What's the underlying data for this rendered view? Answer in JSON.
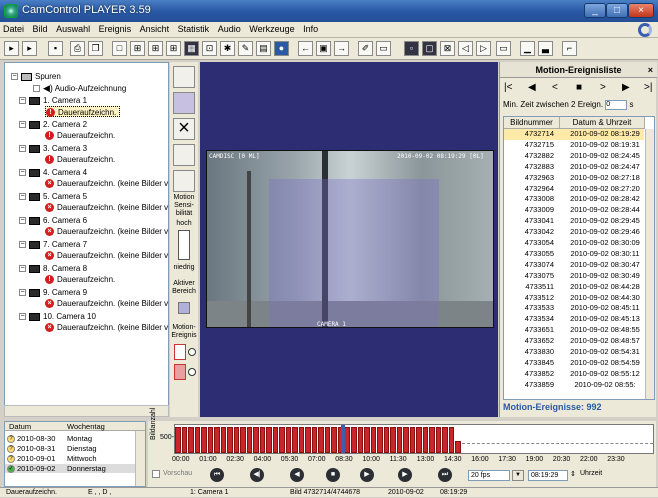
{
  "window": {
    "title": "CamControl PLAYER 3.59"
  },
  "menu": [
    "Datei",
    "Bild",
    "Auswahl",
    "Ereignis",
    "Ansicht",
    "Statistik",
    "Audio",
    "Werkzeuge",
    "Info"
  ],
  "tree": {
    "root": "Spuren",
    "audio": "Audio-Aufzeichnung",
    "items": [
      {
        "label": "1. Camera 1",
        "rec": "Daueraufzeichn.",
        "rec_state": "ok"
      },
      {
        "label": "2. Camera 2",
        "rec": "Daueraufzeichn.",
        "rec_state": "ok"
      },
      {
        "label": "3. Camera 3",
        "rec": "Daueraufzeichn.",
        "rec_state": "ok"
      },
      {
        "label": "4. Camera 4",
        "rec": "Daueraufzeichn. (keine Bilder verf",
        "rec_state": "none"
      },
      {
        "label": "5. Camera 5",
        "rec": "Daueraufzeichn. (keine Bilder verf",
        "rec_state": "none"
      },
      {
        "label": "6. Camera 6",
        "rec": "Daueraufzeichn. (keine Bilder verf",
        "rec_state": "none"
      },
      {
        "label": "7. Camera 7",
        "rec": "Daueraufzeichn. (keine Bilder verf",
        "rec_state": "none"
      },
      {
        "label": "8. Camera 8",
        "rec": "Daueraufzeichn.",
        "rec_state": "ok"
      },
      {
        "label": "9. Camera 9",
        "rec": "Daueraufzeichn. (keine Bilder verf",
        "rec_state": "none"
      },
      {
        "label": "10. Camera 10",
        "rec": "Daueraufzeichn. (keine Bilder verf",
        "rec_state": "none"
      }
    ]
  },
  "midstrip": {
    "motion_label": "Motion Sensi- bilität",
    "high": "hoch",
    "low": "niedrig",
    "active_area": "Aktiver Bereich",
    "motion_events": "Motion- Ereignis"
  },
  "video": {
    "osd_left": "CAMDISC [0 ML]",
    "osd_right": "2010-09-02 08:19:29 [0L]",
    "osd_bottom": "CAMERA 1"
  },
  "events": {
    "title": "Motion-Ereignisliste",
    "close": "×",
    "min_time_label": "Min. Zeit zwischen 2 Ereign.",
    "min_time_value": "0",
    "unit": "s",
    "col_id": "Bildnummer",
    "col_date": "Datum & Uhrzeit",
    "rows": [
      {
        "id": "4732714",
        "dt": "2010-09-02 08:19:29"
      },
      {
        "id": "4732715",
        "dt": "2010-09-02 08:19:31"
      },
      {
        "id": "4732882",
        "dt": "2010-09-02 08:24:45"
      },
      {
        "id": "4732883",
        "dt": "2010-09-02 08:24:47"
      },
      {
        "id": "4732963",
        "dt": "2010-09-02 08:27:18"
      },
      {
        "id": "4732964",
        "dt": "2010-09-02 08:27:20"
      },
      {
        "id": "4733008",
        "dt": "2010-09-02 08:28:42"
      },
      {
        "id": "4733009",
        "dt": "2010-09-02 08:28:44"
      },
      {
        "id": "4733041",
        "dt": "2010-09-02 08:29:45"
      },
      {
        "id": "4733042",
        "dt": "2010-09-02 08:29:46"
      },
      {
        "id": "4733054",
        "dt": "2010-09-02 08:30:09"
      },
      {
        "id": "4733055",
        "dt": "2010-09-02 08:30:11"
      },
      {
        "id": "4733074",
        "dt": "2010-09-02 08:30:47"
      },
      {
        "id": "4733075",
        "dt": "2010-09-02 08:30:49"
      },
      {
        "id": "4733511",
        "dt": "2010-09-02 08:44:28"
      },
      {
        "id": "4733512",
        "dt": "2010-09-02 08:44:30"
      },
      {
        "id": "4733533",
        "dt": "2010-09-02 08:45:11"
      },
      {
        "id": "4733534",
        "dt": "2010-09-02 08:45:13"
      },
      {
        "id": "4733651",
        "dt": "2010-09-02 08:48:55"
      },
      {
        "id": "4733652",
        "dt": "2010-09-02 08:48:57"
      },
      {
        "id": "4733830",
        "dt": "2010-09-02 08:54:31"
      },
      {
        "id": "4733845",
        "dt": "2010-09-02 08:54:59"
      },
      {
        "id": "4733852",
        "dt": "2010-09-02 08:55:12"
      },
      {
        "id": "4733859",
        "dt": "2010-09-02 08:55:"
      }
    ],
    "count_label": "Motion-Ereignisse: 992"
  },
  "dates": {
    "col_date": "Datum",
    "col_day": "Wochentag",
    "rows": [
      {
        "date": "2010-08-30",
        "day": "Montag"
      },
      {
        "date": "2010-08-31",
        "day": "Dienstag"
      },
      {
        "date": "2010-09-01",
        "day": "Mittwoch"
      },
      {
        "date": "2010-09-02",
        "day": "Donnerstag"
      }
    ]
  },
  "timeline": {
    "ylabel": "Bildanzahl",
    "ymark": "500-",
    "ticks": [
      "00:00",
      "01:00",
      "02:30",
      "04:00",
      "05:30",
      "07:00",
      "08:30",
      "10:00",
      "11:30",
      "13:00",
      "14:30",
      "16:00",
      "17:30",
      "19:00",
      "20:30",
      "22:00",
      "23:30"
    ],
    "preview_label": "Vorschau",
    "fps": "20 fps",
    "time_value": "08:19:29",
    "time_unit": "Uhrzeit",
    "bars_filled_until_fraction": 0.6
  },
  "status": {
    "s1": "Daueraufzeichn.",
    "s2": "E , , D ,",
    "s3": "1: Camera 1",
    "s4": "Bild 4732714/4744678",
    "s5": "2010-09-02",
    "s6": "08:19:29"
  }
}
